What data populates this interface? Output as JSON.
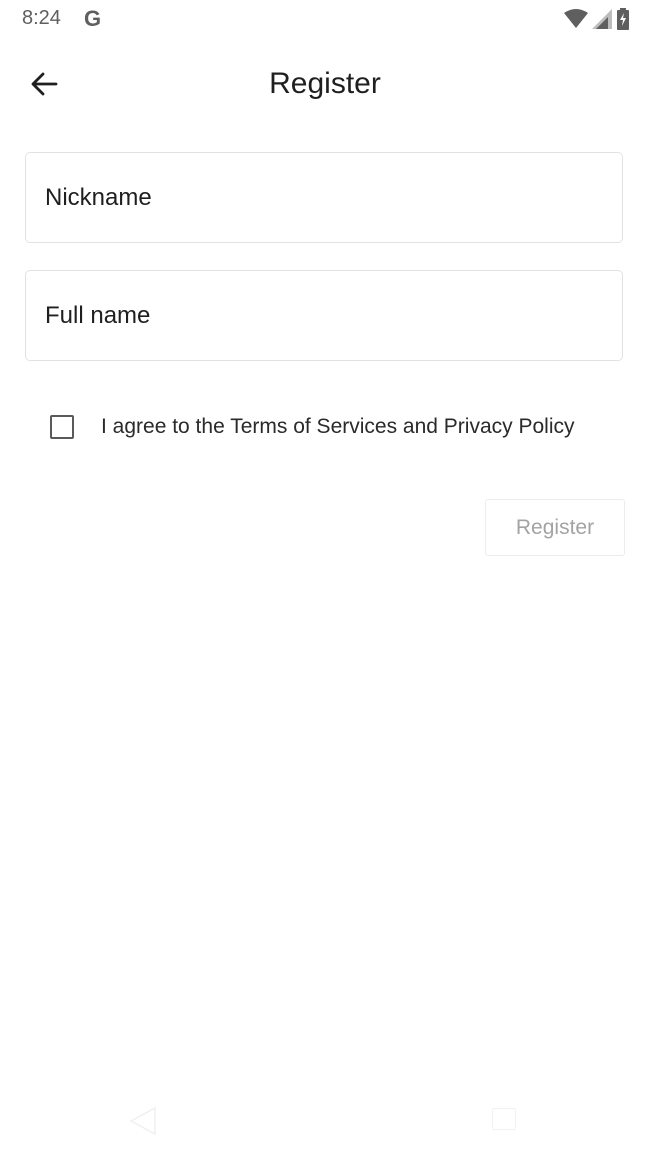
{
  "status_bar": {
    "time": "8:24",
    "google_glyph": "G",
    "icons": [
      "wifi-icon",
      "cellular-signal-icon",
      "battery-charging-icon"
    ]
  },
  "app_bar": {
    "title": "Register",
    "back_icon": "arrow-left-icon"
  },
  "form": {
    "nickname_placeholder": "Nickname",
    "nickname_value": "",
    "fullname_placeholder": "Full name",
    "fullname_value": "",
    "agree_label": "I agree to the Terms of Services and Privacy Policy",
    "agree_checked": false,
    "register_label": "Register",
    "register_enabled": false
  },
  "navigation_bar": {
    "icons": [
      "back-triangle-icon",
      "recents-square-icon"
    ]
  },
  "colors": {
    "text_primary": "#1f1f1f",
    "field_border": "#e2e2e2",
    "button_disabled_text": "#a3a3a3",
    "status_text": "#5f5f5f"
  }
}
